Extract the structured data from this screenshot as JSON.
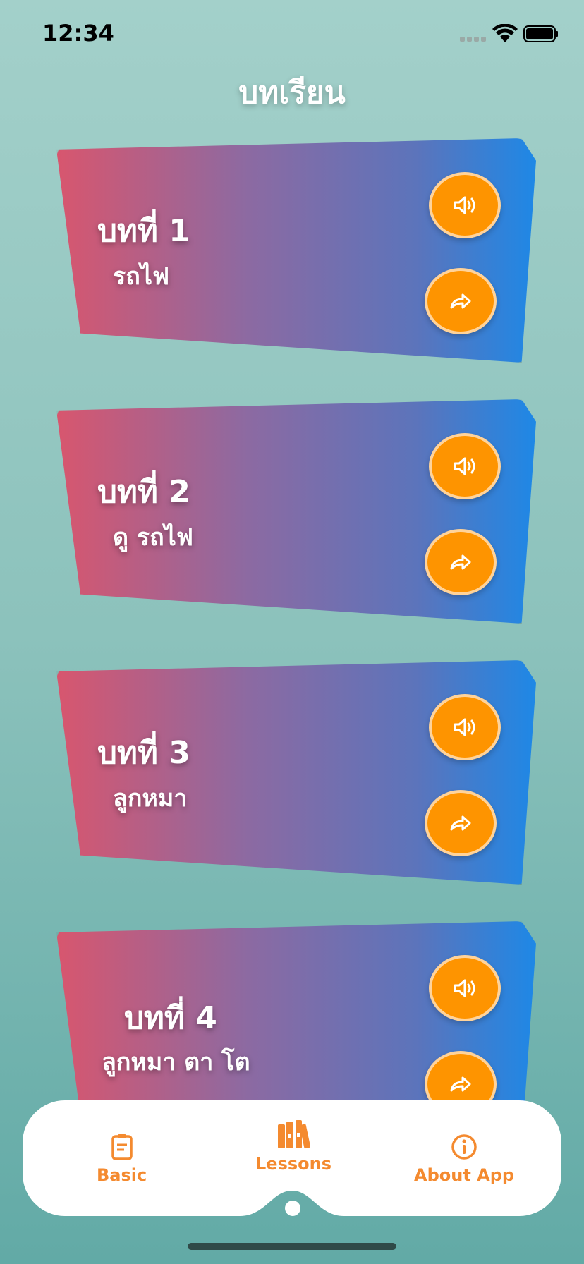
{
  "status_bar": {
    "time": "12:34"
  },
  "header": {
    "title": "บทเรียน"
  },
  "lessons": [
    {
      "title": "บทที่ 1",
      "subtitle": "รถไฟ",
      "sound_icon": "speaker-icon",
      "share_icon": "share-arrow-icon"
    },
    {
      "title": "บทที่ 2",
      "subtitle": "ดู รถไฟ",
      "sound_icon": "speaker-icon",
      "share_icon": "share-arrow-icon"
    },
    {
      "title": "บทที่ 3",
      "subtitle": "ลูกหมา",
      "sound_icon": "speaker-icon",
      "share_icon": "share-arrow-icon"
    },
    {
      "title": "บทที่ 4",
      "subtitle": "ลูกหมา ตา โต",
      "sound_icon": "speaker-icon",
      "share_icon": "share-arrow-icon"
    }
  ],
  "tab_bar": {
    "items": [
      {
        "label": "Basic",
        "icon": "clipboard-icon"
      },
      {
        "label": "Lessons",
        "icon": "books-icon",
        "selected": true
      },
      {
        "label": "About App",
        "icon": "info-icon"
      }
    ]
  },
  "colors": {
    "accent": "#fe9400",
    "tab_label": "#f48a2f",
    "card_gradient_start": "#d8566e",
    "card_gradient_end": "#1e88e6"
  }
}
